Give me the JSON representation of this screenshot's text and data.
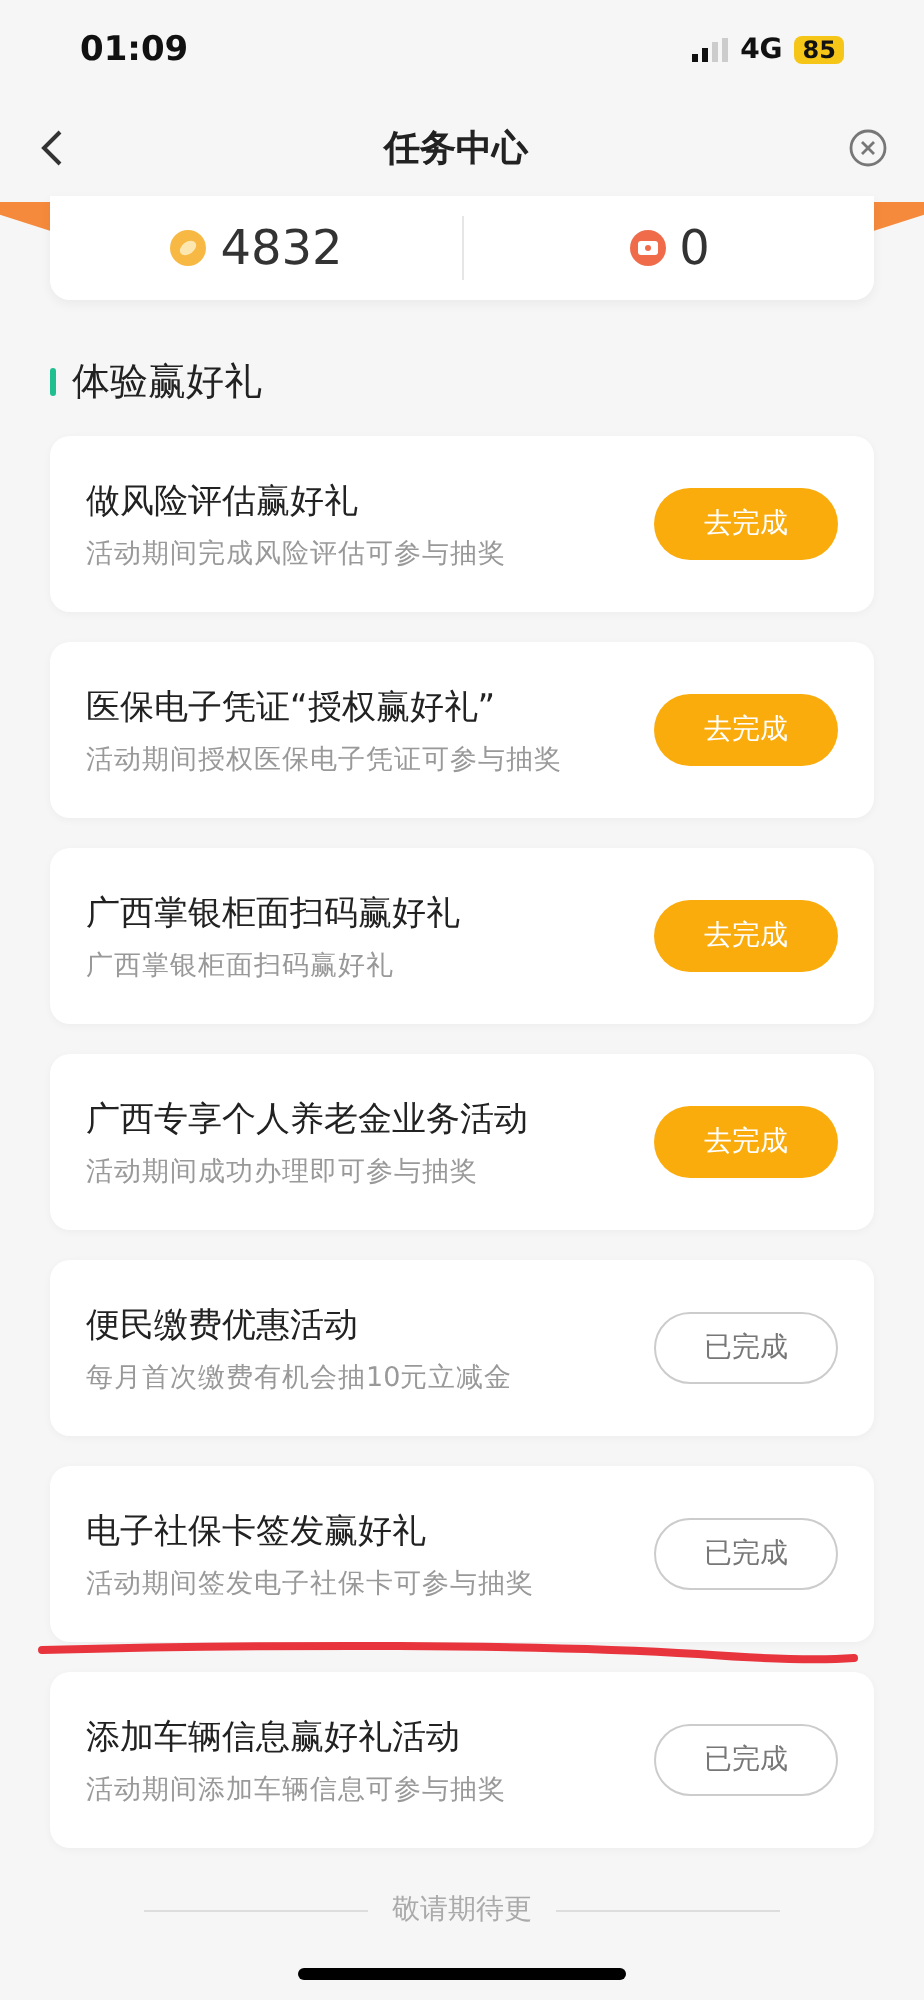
{
  "status_bar": {
    "time": "01:09",
    "network": "4G",
    "battery": "85"
  },
  "nav": {
    "title": "任务中心"
  },
  "stats": [
    {
      "kind": "coin",
      "value": "4832"
    },
    {
      "kind": "ticket",
      "value": "0"
    }
  ],
  "section": {
    "title": "体验赢好礼"
  },
  "tasks": [
    {
      "title": "做风险评估赢好礼",
      "desc": "活动期间完成风险评估可参与抽奖",
      "button": "去完成",
      "done": false,
      "underlined": false
    },
    {
      "title": "医保电子凭证“授权赢好礼”",
      "desc": "活动期间授权医保电子凭证可参与抽奖",
      "button": "去完成",
      "done": false,
      "underlined": false
    },
    {
      "title": "广西掌银柜面扫码赢好礼",
      "desc": "广西掌银柜面扫码赢好礼",
      "button": "去完成",
      "done": false,
      "underlined": false
    },
    {
      "title": "广西专享个人养老金业务活动",
      "desc": "活动期间成功办理即可参与抽奖",
      "button": "去完成",
      "done": false,
      "underlined": false
    },
    {
      "title": "便民缴费优惠活动",
      "desc": "每月首次缴费有机会抽10元立减金",
      "button": "已完成",
      "done": true,
      "underlined": false
    },
    {
      "title": "电子社保卡签发赢好礼",
      "desc": "活动期间签发电子社保卡可参与抽奖",
      "button": "已完成",
      "done": true,
      "underlined": true
    },
    {
      "title": "添加车辆信息赢好礼活动",
      "desc": "活动期间添加车辆信息可参与抽奖",
      "button": "已完成",
      "done": true,
      "underlined": false
    }
  ],
  "footer": {
    "text": "敬请期待更"
  }
}
